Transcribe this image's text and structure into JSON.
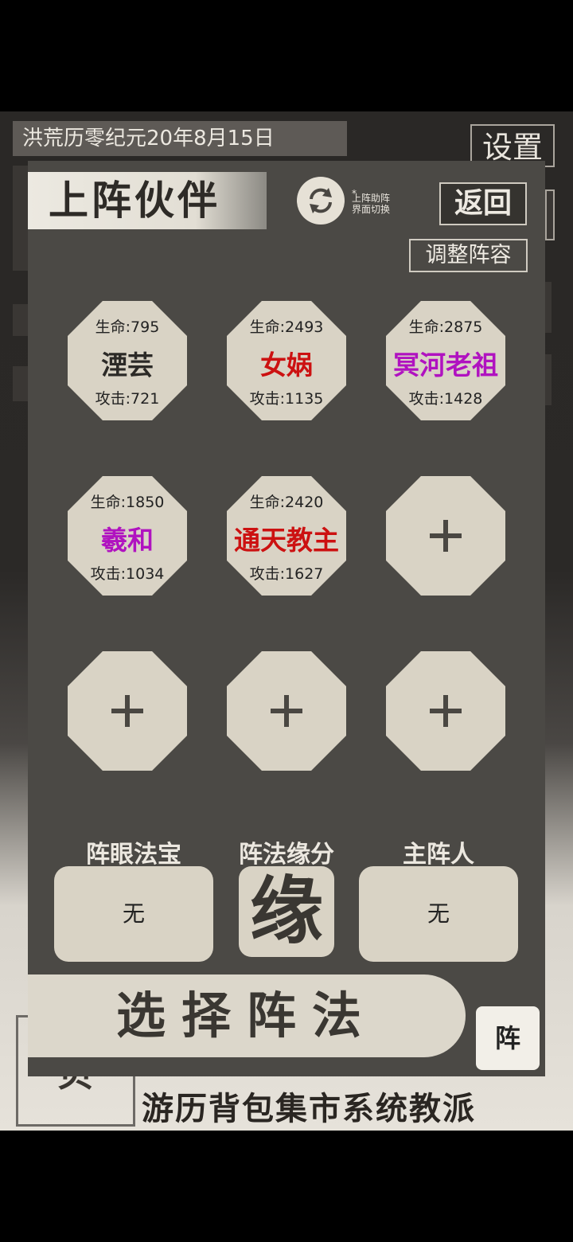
{
  "header": {
    "date": "洪荒历零纪元20年8月15日",
    "settings_label": "设置"
  },
  "bottom_nav": {
    "emblem": "贝",
    "items": "游历背包集市系统教派"
  },
  "panel": {
    "title": "上阵伙伴",
    "switch_star": "*",
    "switch_note_line1": "上阵助阵",
    "switch_note_line2": "界面切换",
    "back_label": "返回",
    "adjust_label": "调整阵容",
    "switch_icon": "refresh-icon"
  },
  "partners": [
    {
      "hp": "生命:795",
      "name": "湮芸",
      "atk": "攻击:721",
      "color": "#2c2a27"
    },
    {
      "hp": "生命:2493",
      "name": "女娲",
      "atk": "攻击:1135",
      "color": "#cc1111"
    },
    {
      "hp": "生命:2875",
      "name": "冥河老祖",
      "atk": "攻击:1428",
      "color": "#b012c0"
    },
    {
      "hp": "生命:1850",
      "name": "羲和",
      "atk": "攻击:1034",
      "color": "#b012c0"
    },
    {
      "hp": "生命:2420",
      "name": "通天教主",
      "atk": "攻击:1627",
      "color": "#cc1111"
    }
  ],
  "empty_slot_icon": "plus-icon",
  "sections": {
    "treasure_label": "阵眼法宝",
    "treasure_value": "无",
    "fate_label": "阵法缘分",
    "fate_char": "缘",
    "master_label": "主阵人",
    "master_value": "无"
  },
  "footer": {
    "select_label": "选择阵法",
    "zhen_label": "阵"
  }
}
